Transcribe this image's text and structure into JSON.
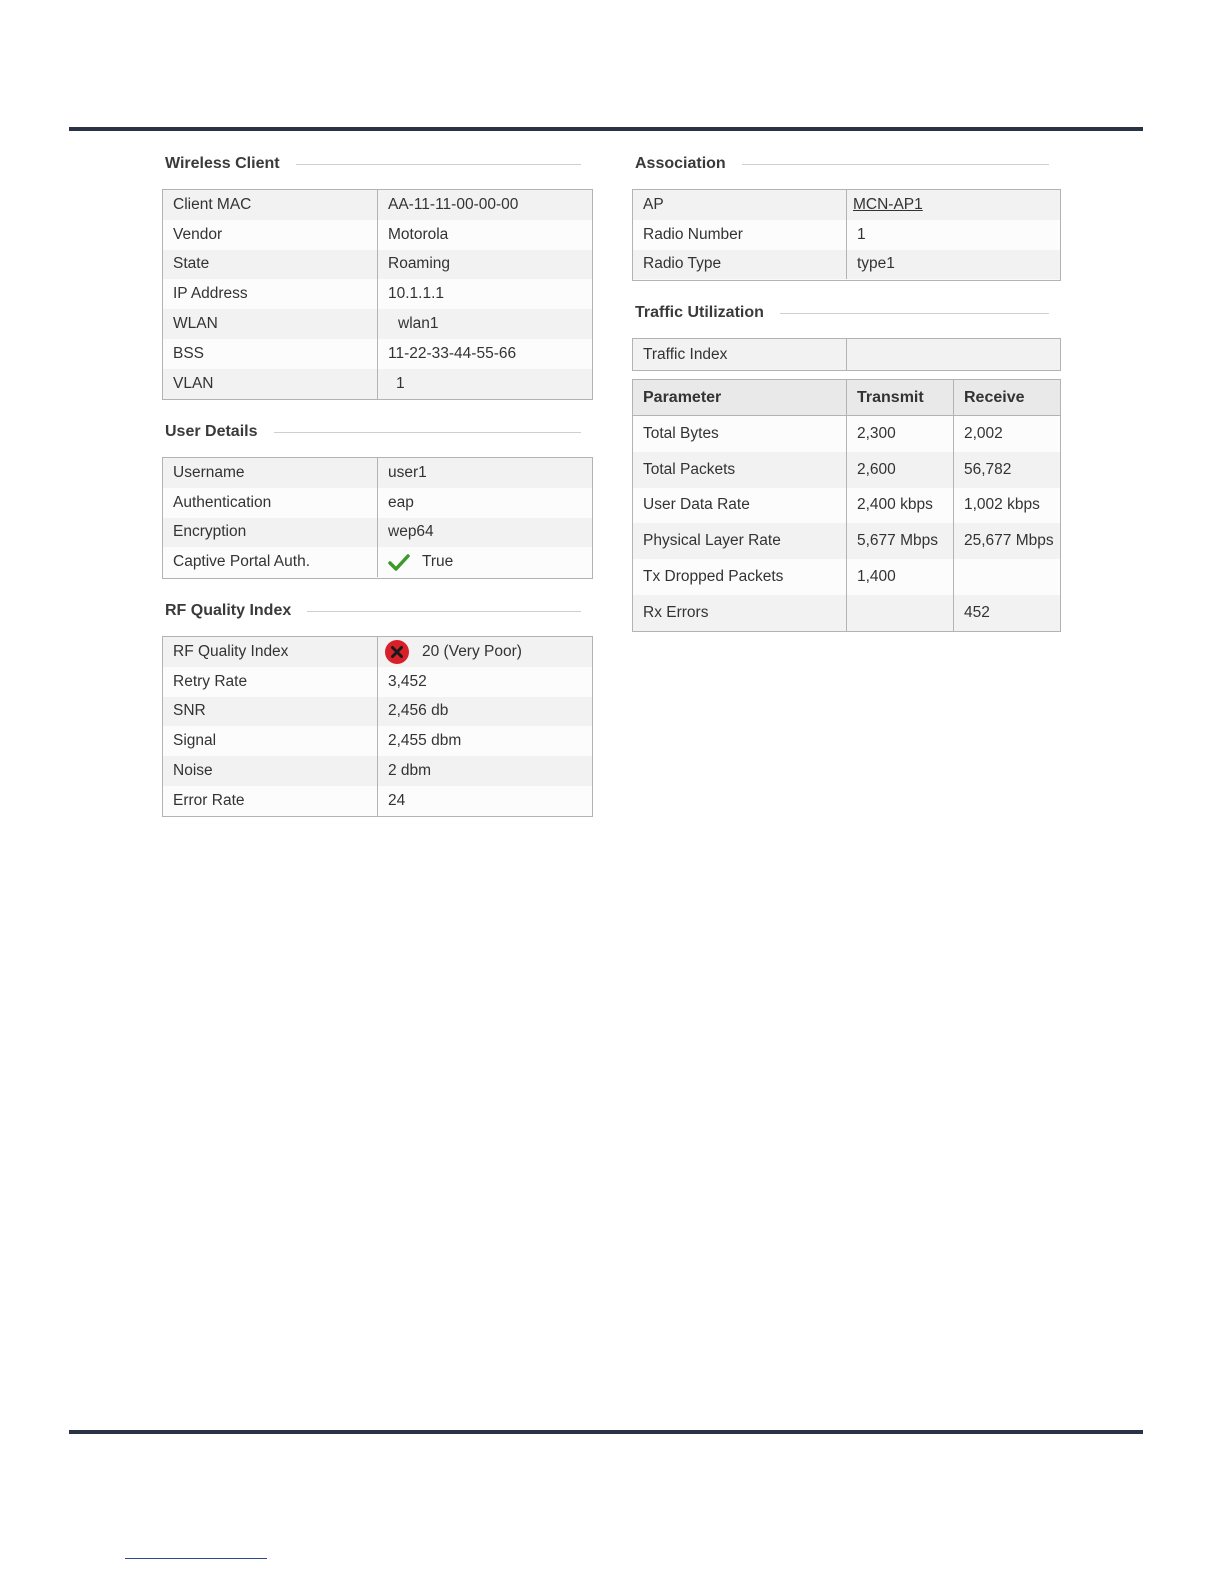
{
  "sections": {
    "wireless_client": {
      "title": "Wireless Client",
      "rows": [
        {
          "label": "Client MAC",
          "value": "AA-11-11-00-00-00"
        },
        {
          "label": "Vendor",
          "value": "Motorola"
        },
        {
          "label": "State",
          "value": "Roaming"
        },
        {
          "label": "IP Address",
          "value": "10.1.1.1"
        },
        {
          "label": "WLAN",
          "value": "wlan1"
        },
        {
          "label": "BSS",
          "value": "11-22-33-44-55-66"
        },
        {
          "label": "VLAN",
          "value": "1"
        }
      ]
    },
    "user_details": {
      "title": "User Details",
      "rows": [
        {
          "label": "Username",
          "value": "user1"
        },
        {
          "label": "Authentication",
          "value": "eap"
        },
        {
          "label": "Encryption",
          "value": "wep64"
        },
        {
          "label": "Captive Portal Auth.",
          "value": "True",
          "icon": "checkmark-icon"
        }
      ]
    },
    "rf_quality": {
      "title": "RF Quality Index",
      "rows": [
        {
          "label": "RF Quality Index",
          "value": "20 (Very Poor)",
          "icon": "error-x-icon"
        },
        {
          "label": "Retry Rate",
          "value": "3,452"
        },
        {
          "label": "SNR",
          "value": "2,456 db"
        },
        {
          "label": "Signal",
          "value": "2,455 dbm"
        },
        {
          "label": "Noise",
          "value": "2 dbm"
        },
        {
          "label": "Error Rate",
          "value": "24"
        }
      ]
    },
    "association": {
      "title": "Association",
      "rows": [
        {
          "label": "AP",
          "value": "MCN-AP1",
          "link": true
        },
        {
          "label": "Radio Number",
          "value": "1"
        },
        {
          "label": "Radio Type",
          "value": "type1"
        }
      ]
    },
    "traffic_utilization": {
      "title": "Traffic Utilization",
      "traffic_index_label": "Traffic Index",
      "traffic_index_value": "",
      "headers": [
        "Parameter",
        "Transmit",
        "Receive"
      ],
      "rows": [
        [
          "Total Bytes",
          "2,300",
          "2,002"
        ],
        [
          "Total Packets",
          "2,600",
          "56,782"
        ],
        [
          "User Data Rate",
          "2,400 kbps",
          "1,002 kbps"
        ],
        [
          "Physical Layer Rate",
          "5,677 Mbps",
          "25,677 Mbps"
        ],
        [
          "Tx Dropped Packets",
          "1,400",
          ""
        ],
        [
          "Rx Errors",
          "",
          "452"
        ]
      ]
    }
  },
  "colors": {
    "rule": "#2a3346",
    "ok_green": "#3a9a2a",
    "error_red": "#d8202a"
  }
}
